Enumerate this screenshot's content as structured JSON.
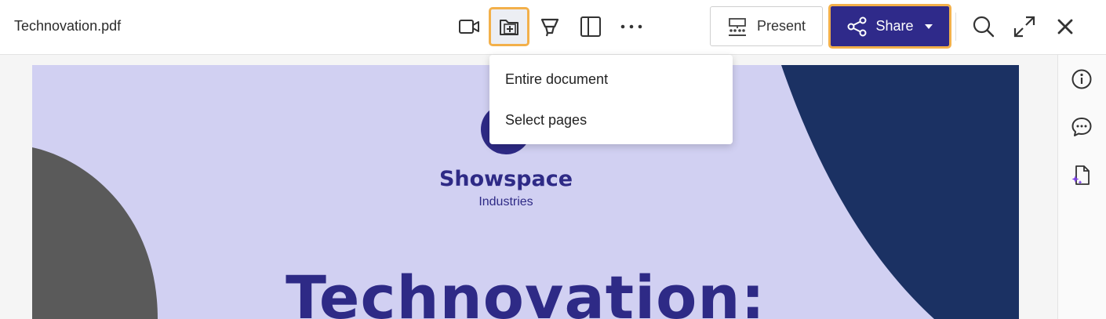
{
  "header": {
    "file_name": "Technovation.pdf",
    "present_label": "Present",
    "share_label": "Share"
  },
  "toolbar_icons": [
    "video-icon",
    "add-to-folder-icon",
    "highlighter-icon",
    "side-panel-icon",
    "more-icon"
  ],
  "share_menu": {
    "items": [
      "Entire document",
      "Select pages"
    ]
  },
  "right_rail": {
    "icons": [
      "info-icon",
      "comment-icon",
      "ai-document-icon"
    ]
  },
  "document": {
    "brand_name": "Showspace",
    "brand_sub": "Industries",
    "headline": "Technovation:"
  },
  "colors": {
    "accent": "#2f2a8a",
    "highlight": "#f3b04a",
    "page_bg": "#d1d0f2",
    "navy_shape": "#1b3163",
    "gray_shape": "#5a5a5a"
  }
}
